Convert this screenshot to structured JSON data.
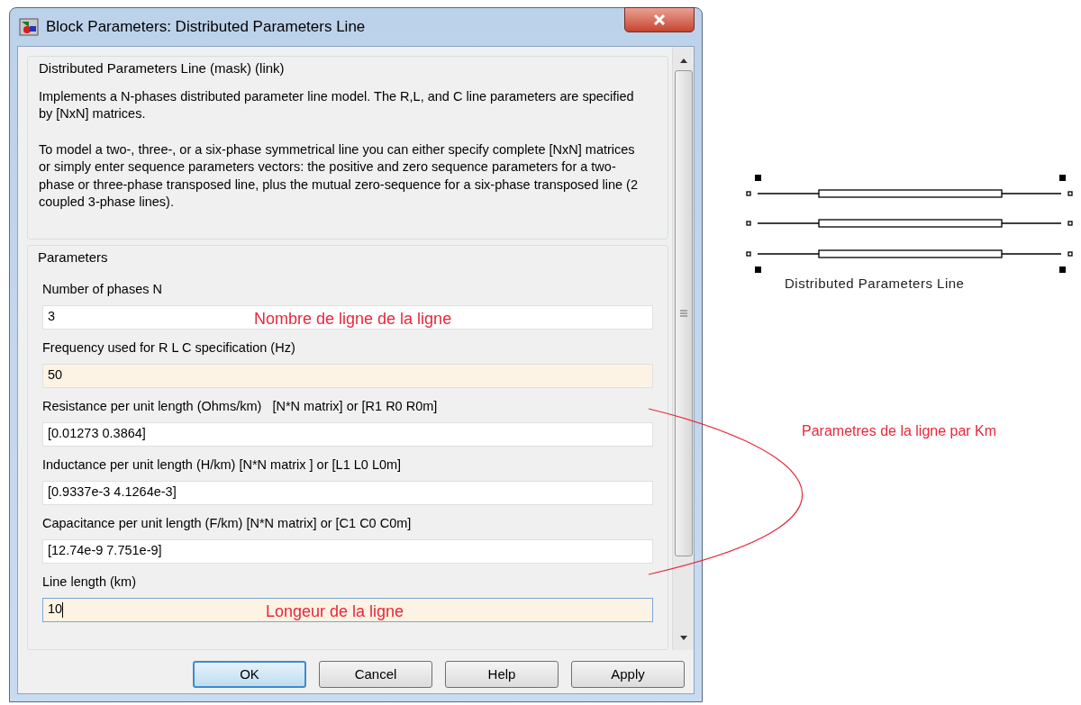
{
  "window": {
    "title": "Block Parameters: Distributed Parameters Line"
  },
  "description": {
    "title": "Distributed Parameters Line (mask) (link)",
    "paragraphs": [
      "Implements a N-phases distributed parameter line model. The R,L, and C line parameters are specified by [NxN] matrices.",
      "To model a two-, three-, or a six-phase symmetrical line you can either specify complete [NxN] matrices or simply enter sequence parameters vectors: the positive and zero sequence parameters for a two-phase or  three-phase transposed  line, plus the mutual zero-sequence for a  six-phase transposed line  (2 coupled 3-phase lines)."
    ]
  },
  "parameters": {
    "title": "Parameters",
    "fields": [
      {
        "label": "Number of phases N",
        "value": "3",
        "highlighted": false,
        "focused": false,
        "annotation": "Nombre de ligne de la ligne"
      },
      {
        "label": "Frequency used for R L C specification (Hz)",
        "value": "50",
        "highlighted": true,
        "focused": false
      },
      {
        "label": "Resistance per unit length (Ohms/km)   [N*N matrix] or [R1 R0 R0m]",
        "value": "[0.01273 0.3864]",
        "highlighted": false,
        "focused": false
      },
      {
        "label": "Inductance per unit length (H/km) [N*N matrix ] or [L1 L0 L0m]",
        "value": "[0.9337e-3  4.1264e-3]",
        "highlighted": false,
        "focused": false
      },
      {
        "label": "Capacitance per unit length (F/km) [N*N matrix] or [C1 C0 C0m]",
        "value": "[12.74e-9 7.751e-9]",
        "highlighted": false,
        "focused": false
      },
      {
        "label": "Line length (km)",
        "value": "10",
        "highlighted": true,
        "focused": true,
        "annotation": "Longeur de la ligne"
      }
    ]
  },
  "buttons": [
    {
      "label": "OK",
      "default": true
    },
    {
      "label": "Cancel",
      "default": false
    },
    {
      "label": "Help",
      "default": false
    },
    {
      "label": "Apply",
      "default": false
    }
  ],
  "block": {
    "label": "Distributed Parameters Line"
  },
  "annotation": {
    "text": "Parametres de la ligne par Km"
  }
}
